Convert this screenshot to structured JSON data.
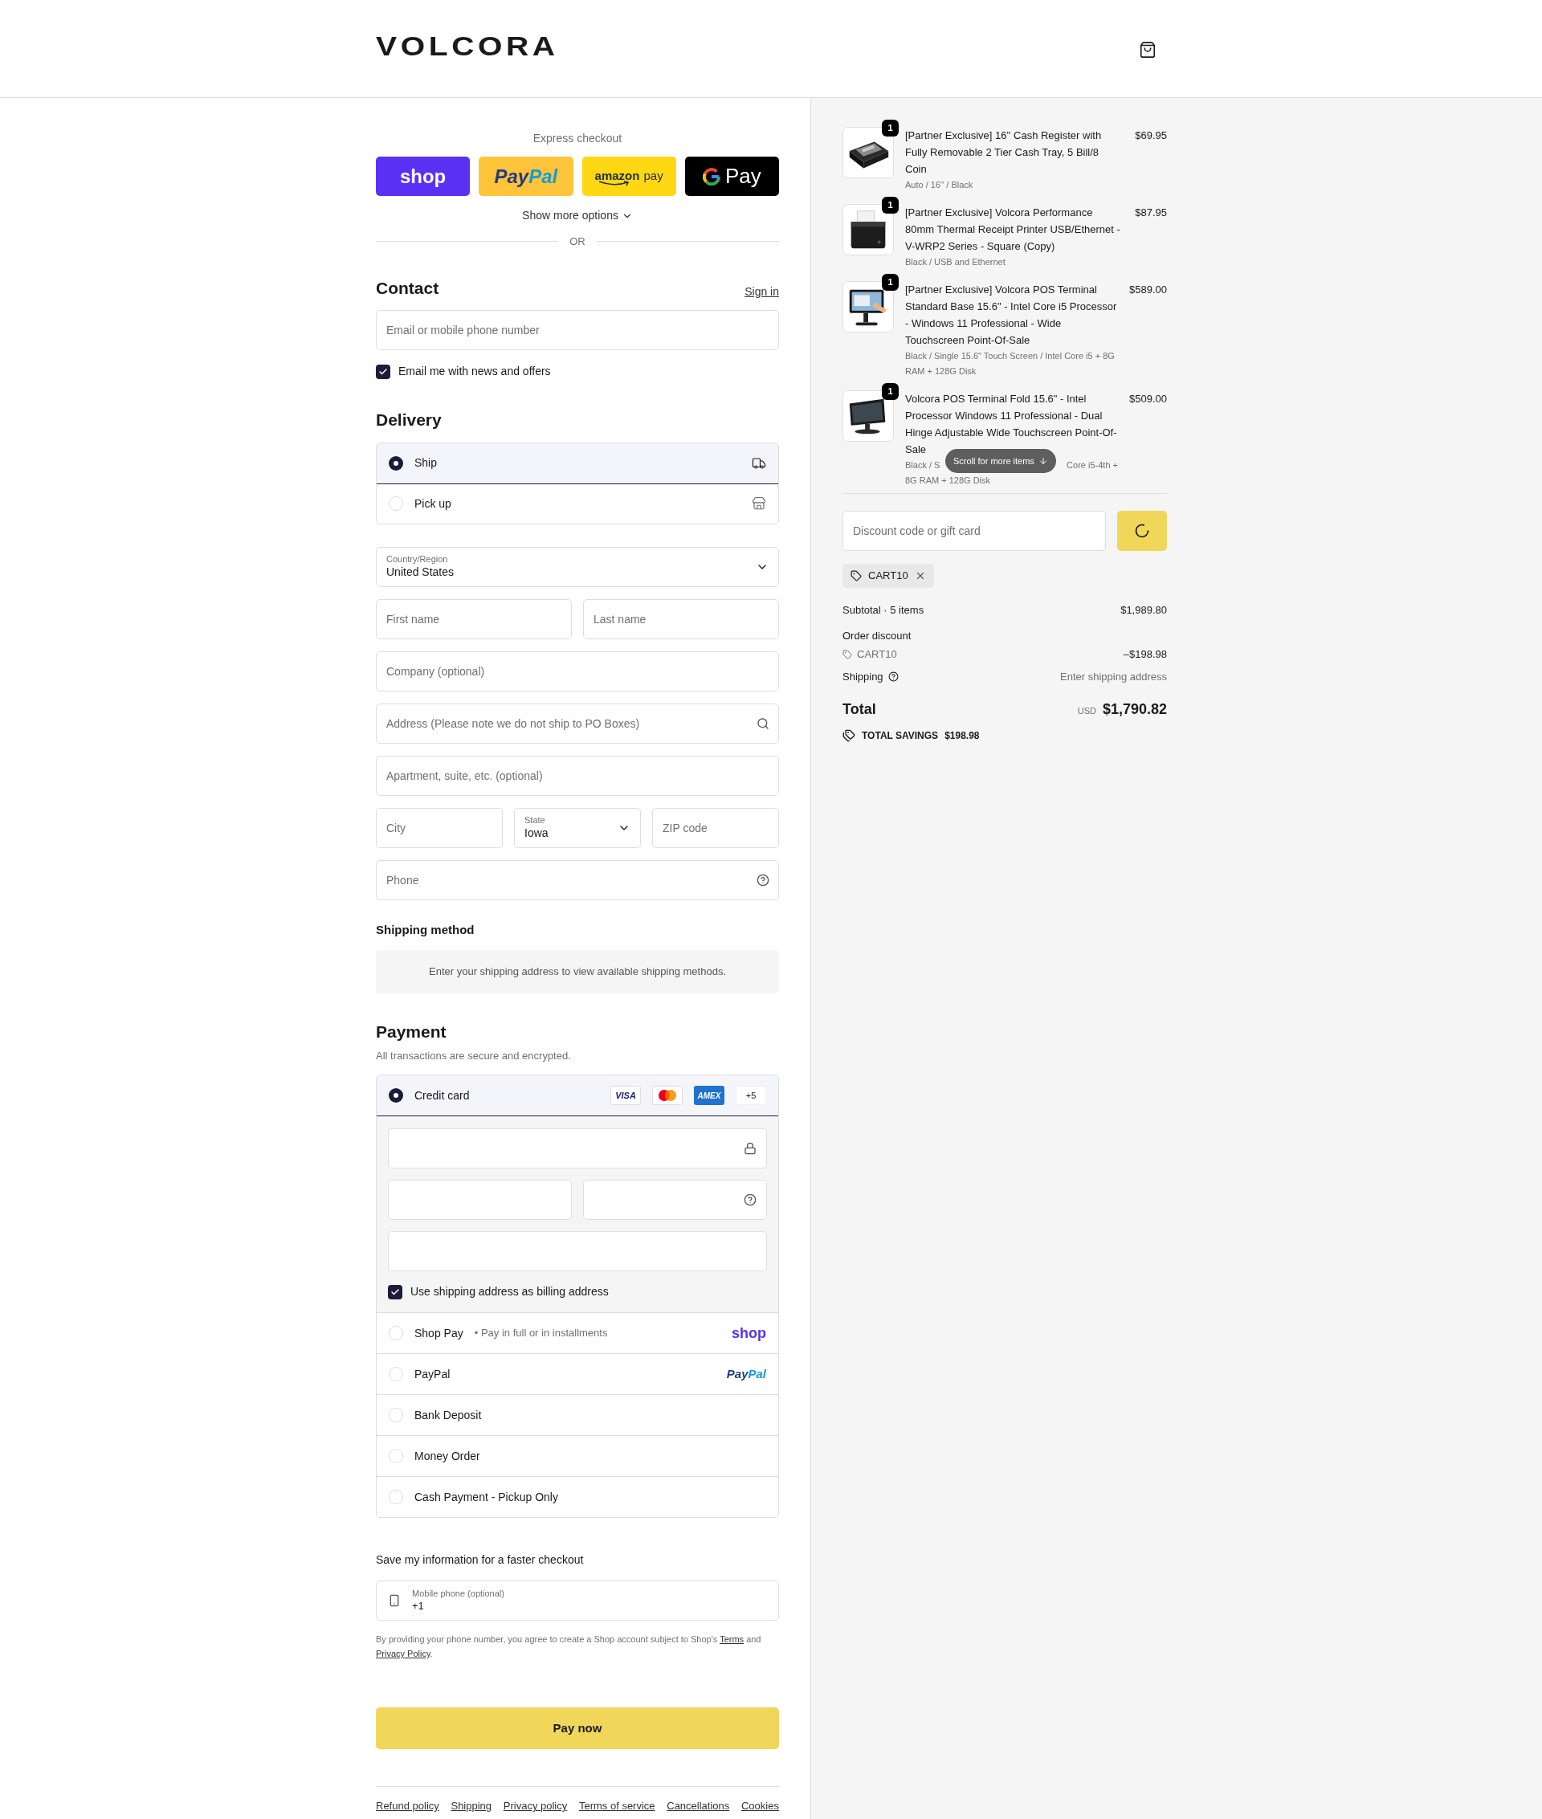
{
  "header": {
    "logo": "VOLCORA"
  },
  "express_checkout": {
    "title": "Express checkout",
    "buttons": [
      {
        "kind": "shop",
        "parts": [
          "shop"
        ]
      },
      {
        "kind": "paypal",
        "parts": [
          "Pay",
          "Pal"
        ]
      },
      {
        "kind": "amazon",
        "parts": [
          "amazon",
          "pay"
        ]
      },
      {
        "kind": "gpay",
        "parts": [
          "Pay"
        ]
      }
    ],
    "more_options": "Show more options",
    "divider": "OR"
  },
  "contact": {
    "title": "Contact",
    "sign_in": "Sign in",
    "email_placeholder": "Email or mobile phone number",
    "newsletter": {
      "label": "Email me with news and offers",
      "checked": true
    }
  },
  "delivery": {
    "title": "Delivery",
    "options": [
      {
        "kind": "ship",
        "label": "Ship",
        "selected": true
      },
      {
        "kind": "pickup",
        "label": "Pick up",
        "selected": false
      }
    ],
    "country": {
      "label": "Country/Region",
      "value": "United States"
    },
    "first_name_placeholder": "First name",
    "last_name_placeholder": "Last name",
    "company_placeholder": "Company (optional)",
    "address_placeholder": "Address (Please note we do not ship to PO Boxes)",
    "apartment_placeholder": "Apartment, suite, etc. (optional)",
    "city_placeholder": "City",
    "state": {
      "label": "State",
      "value": "Iowa"
    },
    "zip_placeholder": "ZIP code",
    "phone_placeholder": "Phone"
  },
  "shipping_method": {
    "title": "Shipping method",
    "message": "Enter your shipping address to view available shipping methods."
  },
  "payment": {
    "title": "Payment",
    "subtitle": "All transactions are secure and encrypted.",
    "methods": [
      {
        "kind": "card",
        "label": "Credit card",
        "selected": true,
        "brands": [
          {
            "kind": "visa",
            "label": "VISA"
          },
          {
            "kind": "mastercard"
          },
          {
            "kind": "amex",
            "label": "AMEX"
          },
          {
            "kind": "more",
            "label": "+5"
          }
        ],
        "billing": {
          "label": "Use shipping address as billing address",
          "checked": true
        }
      },
      {
        "kind": "shop_pay",
        "label": "Shop Pay",
        "selected": false,
        "separator": "•",
        "note": "Pay in full or in installments",
        "logo": [
          "shop"
        ]
      },
      {
        "kind": "paypal",
        "label": "PayPal",
        "selected": false,
        "logo": [
          "Pay",
          "Pal"
        ]
      },
      {
        "kind": "plain",
        "label": "Bank Deposit",
        "selected": false
      },
      {
        "kind": "plain",
        "label": "Money Order",
        "selected": false
      },
      {
        "kind": "plain",
        "label": "Cash Payment - Pickup Only",
        "selected": false
      }
    ]
  },
  "save_info": {
    "title": "Save my information for a faster checkout",
    "phone": {
      "label": "Mobile phone (optional)",
      "value": "+1"
    },
    "legal": {
      "before": "By providing your phone number, you agree to create a Shop account subject to Shop's ",
      "terms": "Terms",
      "middle": " and ",
      "privacy": "Privacy Policy",
      "after": "."
    }
  },
  "pay_button": "Pay now",
  "footer_links": [
    "Refund policy",
    "Shipping",
    "Privacy policy",
    "Terms of service",
    "Cancellations",
    "Cookies"
  ],
  "summary": {
    "items": [
      {
        "name": "[Partner Exclusive] 16'' Cash Register with Fully Removable 2 Tier Cash Tray, 5 Bill/8 Coin",
        "variant": [
          "Auto / 16'' / Black"
        ],
        "price": "$69.95",
        "quantity": "1"
      },
      {
        "name": "[Partner Exclusive] Volcora Performance 80mm Thermal Receipt Printer USB/Ethernet - V-WRP2 Series - Square (Copy)",
        "variant": [
          "Black / USB and Ethernet"
        ],
        "price": "$87.95",
        "quantity": "1"
      },
      {
        "name": "[Partner Exclusive] Volcora POS Terminal Standard Base 15.6\" - Intel Core i5 Processor - Windows 11 Professional - Wide Touchscreen Point-Of-Sale",
        "variant": [
          "Black / Single 15.6\" Touch Screen / Intel Core i5 + 8G RAM + 128G Disk"
        ],
        "price": "$589.00",
        "quantity": "1"
      },
      {
        "name": "Volcora POS Terminal Fold 15.6\" - Intel Processor Windows 11 Professional - Dual Hinge Adjustable Wide Touchscreen Point-Of-Sale",
        "variant": [
          "Black / S",
          "Core i5-4th +",
          "8G RAM + 128G Disk"
        ],
        "price": "$509.00",
        "quantity": "1"
      }
    ],
    "scroll_hint": "Scroll for more items",
    "discount_placeholder": "Discount code or gift card",
    "applied_code": "CART10",
    "subtotal": {
      "label": "Subtotal · 5 items",
      "value": "$1,989.80"
    },
    "order_discount": {
      "label": "Order discount",
      "code": "CART10",
      "value": "–$198.98"
    },
    "shipping": {
      "label": "Shipping",
      "value": "Enter shipping address"
    },
    "total": {
      "label": "Total",
      "currency": "USD",
      "value": "$1,790.82"
    },
    "savings": {
      "label": "TOTAL SAVINGS",
      "value": "$198.98"
    }
  }
}
